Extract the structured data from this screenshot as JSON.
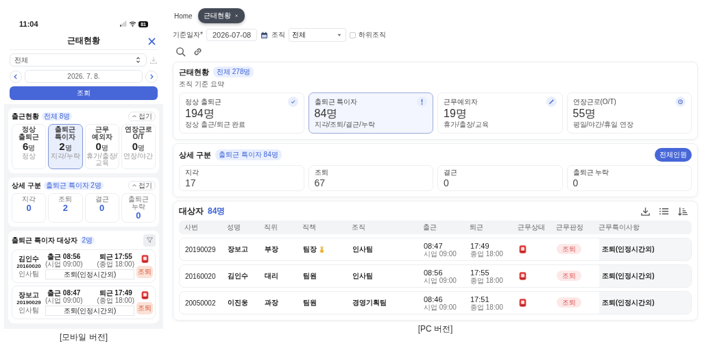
{
  "mobile": {
    "status_bar": {
      "time": "11:04",
      "battery": "81"
    },
    "title": "근태현황",
    "org_select": {
      "value": "전체"
    },
    "date": "2026. 7. 8.",
    "search_button": "조회",
    "summary": {
      "title": "출근현황",
      "badge": "전체 8명",
      "collapse": "접기",
      "cards": [
        {
          "label": "정상 출퇴근",
          "count": "6",
          "unit": "명",
          "sub": "정상",
          "selected": false
        },
        {
          "label": "출퇴근 특이자",
          "count": "2",
          "unit": "명",
          "sub": "지각/누락",
          "selected": true
        },
        {
          "label": "근무 예외자",
          "count": "0",
          "unit": "명",
          "sub": "휴가/출장/교육",
          "selected": false
        },
        {
          "label": "연장근로 O/T",
          "count": "0",
          "unit": "명",
          "sub": "연장/야간",
          "selected": false
        }
      ]
    },
    "detail": {
      "title": "상세 구분",
      "badge": "출퇴근 특이자 2명",
      "collapse": "접기",
      "items": [
        {
          "label": "지각",
          "value": "0"
        },
        {
          "label": "조퇴",
          "value": "2"
        },
        {
          "label": "결근",
          "value": "0"
        },
        {
          "label": "출퇴근 누락",
          "value": "0"
        }
      ]
    },
    "list": {
      "title": "출퇴근 특이자 대상자",
      "badge": "2명",
      "records": [
        {
          "name": "김인수",
          "emp_no": "20160020",
          "dept": "인사팀",
          "in": "출근 08:56",
          "in_sched": "(시업 09:00)",
          "out": "퇴근 17:55",
          "out_sched": "(종업 18:00)",
          "note": "조퇴(인정시간외)",
          "status": "조퇴"
        },
        {
          "name": "장보고",
          "emp_no": "20190029",
          "dept": "인사팀",
          "in": "출근 08:47",
          "in_sched": "(시업 09:00)",
          "out": "퇴근 17:49",
          "out_sched": "(종업 18:00)",
          "note": "조퇴(인정시간외)",
          "status": "조퇴"
        }
      ]
    },
    "caption": "[모바일 버전]"
  },
  "pc": {
    "tabs": [
      {
        "label": "Home",
        "selected": false
      },
      {
        "label": "근태현황",
        "selected": true
      }
    ],
    "filters": {
      "date_label": "기준일자*",
      "date": "2026-07-08",
      "org_label": "조직",
      "org_value": "전체",
      "sub_org": {
        "label": "하위조직",
        "checked": false
      }
    },
    "summary": {
      "title": "근태현황",
      "badge": "전체 278명",
      "subtitle": "조직 기준 요약",
      "cards": [
        {
          "label": "정상 출퇴근",
          "value": "194명",
          "sub": "정상 출근/퇴근 완료",
          "selected": false
        },
        {
          "label": "출퇴근 특이자",
          "value": "84명",
          "sub": "지각/조퇴/결근/누락",
          "selected": true
        },
        {
          "label": "근무예외자",
          "value": "19명",
          "sub": "휴가/출장/교육",
          "selected": false
        },
        {
          "label": "연장근로(O/T)",
          "value": "55명",
          "sub": "평일/야간/휴일 연장",
          "selected": false
        }
      ]
    },
    "detail": {
      "title": "상세 구분",
      "badge": "출퇴근 특이자 84명",
      "button": "전체인원",
      "items": [
        {
          "label": "지각",
          "value": "17"
        },
        {
          "label": "조퇴",
          "value": "67"
        },
        {
          "label": "결근",
          "value": "0"
        },
        {
          "label": "출퇴근 누락",
          "value": "0"
        }
      ]
    },
    "table": {
      "title": "대상자",
      "count": "84명",
      "columns": [
        "사번",
        "성명",
        "직위",
        "직책",
        "조직",
        "출근",
        "퇴근",
        "근무상태",
        "근무판정",
        "근무특이사항"
      ],
      "rows": [
        {
          "emp_no": "20190029",
          "name": "장보고",
          "position": "부장",
          "role": "팀장",
          "medal": true,
          "dept": "인사팀",
          "in": "08:47",
          "in_sched": "시업 09:00",
          "out": "17:49",
          "out_sched": "종업 18:00",
          "judgment": "조퇴",
          "note": "조퇴(인정시간외)"
        },
        {
          "emp_no": "20160020",
          "name": "김인수",
          "position": "대리",
          "role": "팀원",
          "medal": false,
          "dept": "인사팀",
          "in": "08:56",
          "in_sched": "시업 09:00",
          "out": "17:55",
          "out_sched": "종업 18:00",
          "judgment": "조퇴",
          "note": "조퇴(인정시간외)"
        },
        {
          "emp_no": "20050002",
          "name": "이진웅",
          "position": "과장",
          "role": "팀원",
          "medal": false,
          "dept": "경영기획팀",
          "in": "08:46",
          "in_sched": "시업 09:00",
          "out": "17:51",
          "out_sched": "종업 18:00",
          "judgment": "조퇴",
          "note": "조퇴(인정시간외)"
        }
      ]
    },
    "caption": "[PC 버전]"
  }
}
